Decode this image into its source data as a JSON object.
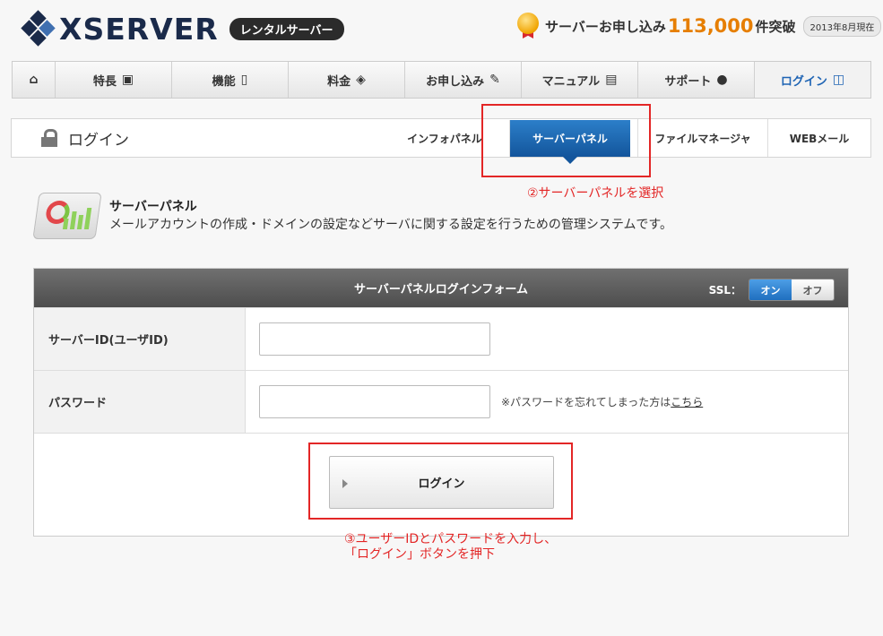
{
  "header": {
    "logo_text": "XSERVER",
    "badge": "レンタルサーバー",
    "promo_prefix": "サーバーお申し込み",
    "promo_number": "113,000",
    "promo_suffix": "件突破",
    "promo_date": "2013年8月現在"
  },
  "mainnav": {
    "items": [
      {
        "label": "",
        "icon": "home-icon"
      },
      {
        "label": "特長",
        "icon": "monitor-icon"
      },
      {
        "label": "機能",
        "icon": "mouse-icon"
      },
      {
        "label": "料金",
        "icon": "tag-icon"
      },
      {
        "label": "お申し込み",
        "icon": "pencil-icon"
      },
      {
        "label": "マニュアル",
        "icon": "book-icon"
      },
      {
        "label": "サポート",
        "icon": "user-icon"
      },
      {
        "label": "ログイン",
        "icon": "lock-icon"
      }
    ]
  },
  "subnav": {
    "title": "ログイン",
    "tabs": [
      "インフォパネル",
      "サーバーパネル",
      "ファイルマネージャ",
      "WEBメール"
    ],
    "active_tab": "サーバーパネル"
  },
  "annotations": {
    "step2": "②サーバーパネルを選択",
    "step3_line1": "③ユーザーIDとパスワードを入力し、",
    "step3_line2": "「ログイン」ボタンを押下"
  },
  "intro": {
    "title": "サーバーパネル",
    "description": "メールアカウントの作成・ドメインの設定などサーバに関する設定を行うための管理システムです。"
  },
  "form": {
    "title": "サーバーパネルログインフォーム",
    "ssl_label": "SSL：",
    "ssl_on": "オン",
    "ssl_off": "オフ",
    "server_id_label": "サーバーID(ユーザID)",
    "server_id_value": "",
    "password_label": "パスワード",
    "password_value": "",
    "forgot_text": "※パスワードを忘れてしまった方は",
    "forgot_link": "こちら",
    "login_button": "ログイン"
  },
  "colors": {
    "accent_blue": "#1e64b4",
    "annotation_red": "#e32626",
    "promo_orange": "#e67e00"
  }
}
